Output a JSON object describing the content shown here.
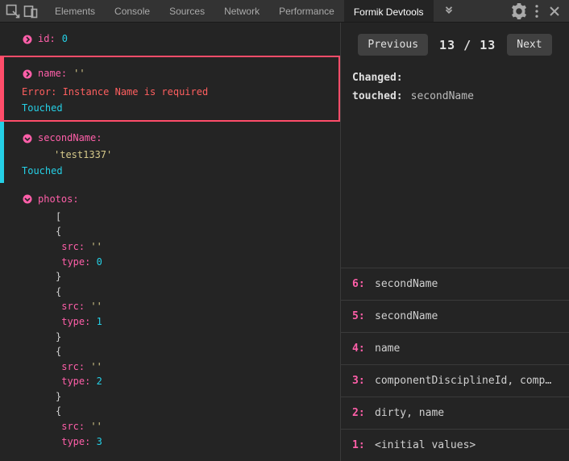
{
  "header": {
    "tabs": [
      "Elements",
      "Console",
      "Sources",
      "Network",
      "Performance",
      "Formik Devtools"
    ],
    "active_tab": "Formik Devtools"
  },
  "fields": {
    "id": {
      "key": "id:",
      "value": "0"
    },
    "name": {
      "key": "name:",
      "value": "''",
      "error": "Error: Instance Name is required",
      "touched": "Touched"
    },
    "secondName": {
      "key": "secondName:",
      "value": "'test1337'",
      "touched": "Touched"
    },
    "photos": {
      "key": "photos:",
      "open_bracket": "[",
      "items": [
        {
          "open": "{",
          "src_key": "src:",
          "src_val": "''",
          "type_key": "type:",
          "type_val": "0",
          "close": "}"
        },
        {
          "open": "{",
          "src_key": "src:",
          "src_val": "''",
          "type_key": "type:",
          "type_val": "1",
          "close": "}"
        },
        {
          "open": "{",
          "src_key": "src:",
          "src_val": "''",
          "type_key": "type:",
          "type_val": "2",
          "close": "}"
        },
        {
          "open": "{",
          "src_key": "src:",
          "src_val": "''",
          "type_key": "type:",
          "type_val": "3",
          "close": "}"
        }
      ]
    }
  },
  "nav": {
    "previous": "Previous",
    "counter": "13 / 13",
    "next": "Next"
  },
  "changed": {
    "title": "Changed:",
    "label": "touched:",
    "value": "secondName"
  },
  "history": [
    {
      "idx": "6:",
      "text": "secondName"
    },
    {
      "idx": "5:",
      "text": "secondName"
    },
    {
      "idx": "4:",
      "text": "name"
    },
    {
      "idx": "3:",
      "text": "componentDisciplineId, comp…"
    },
    {
      "idx": "2:",
      "text": "dirty, name"
    },
    {
      "idx": "1:",
      "text": "<initial values>"
    }
  ]
}
